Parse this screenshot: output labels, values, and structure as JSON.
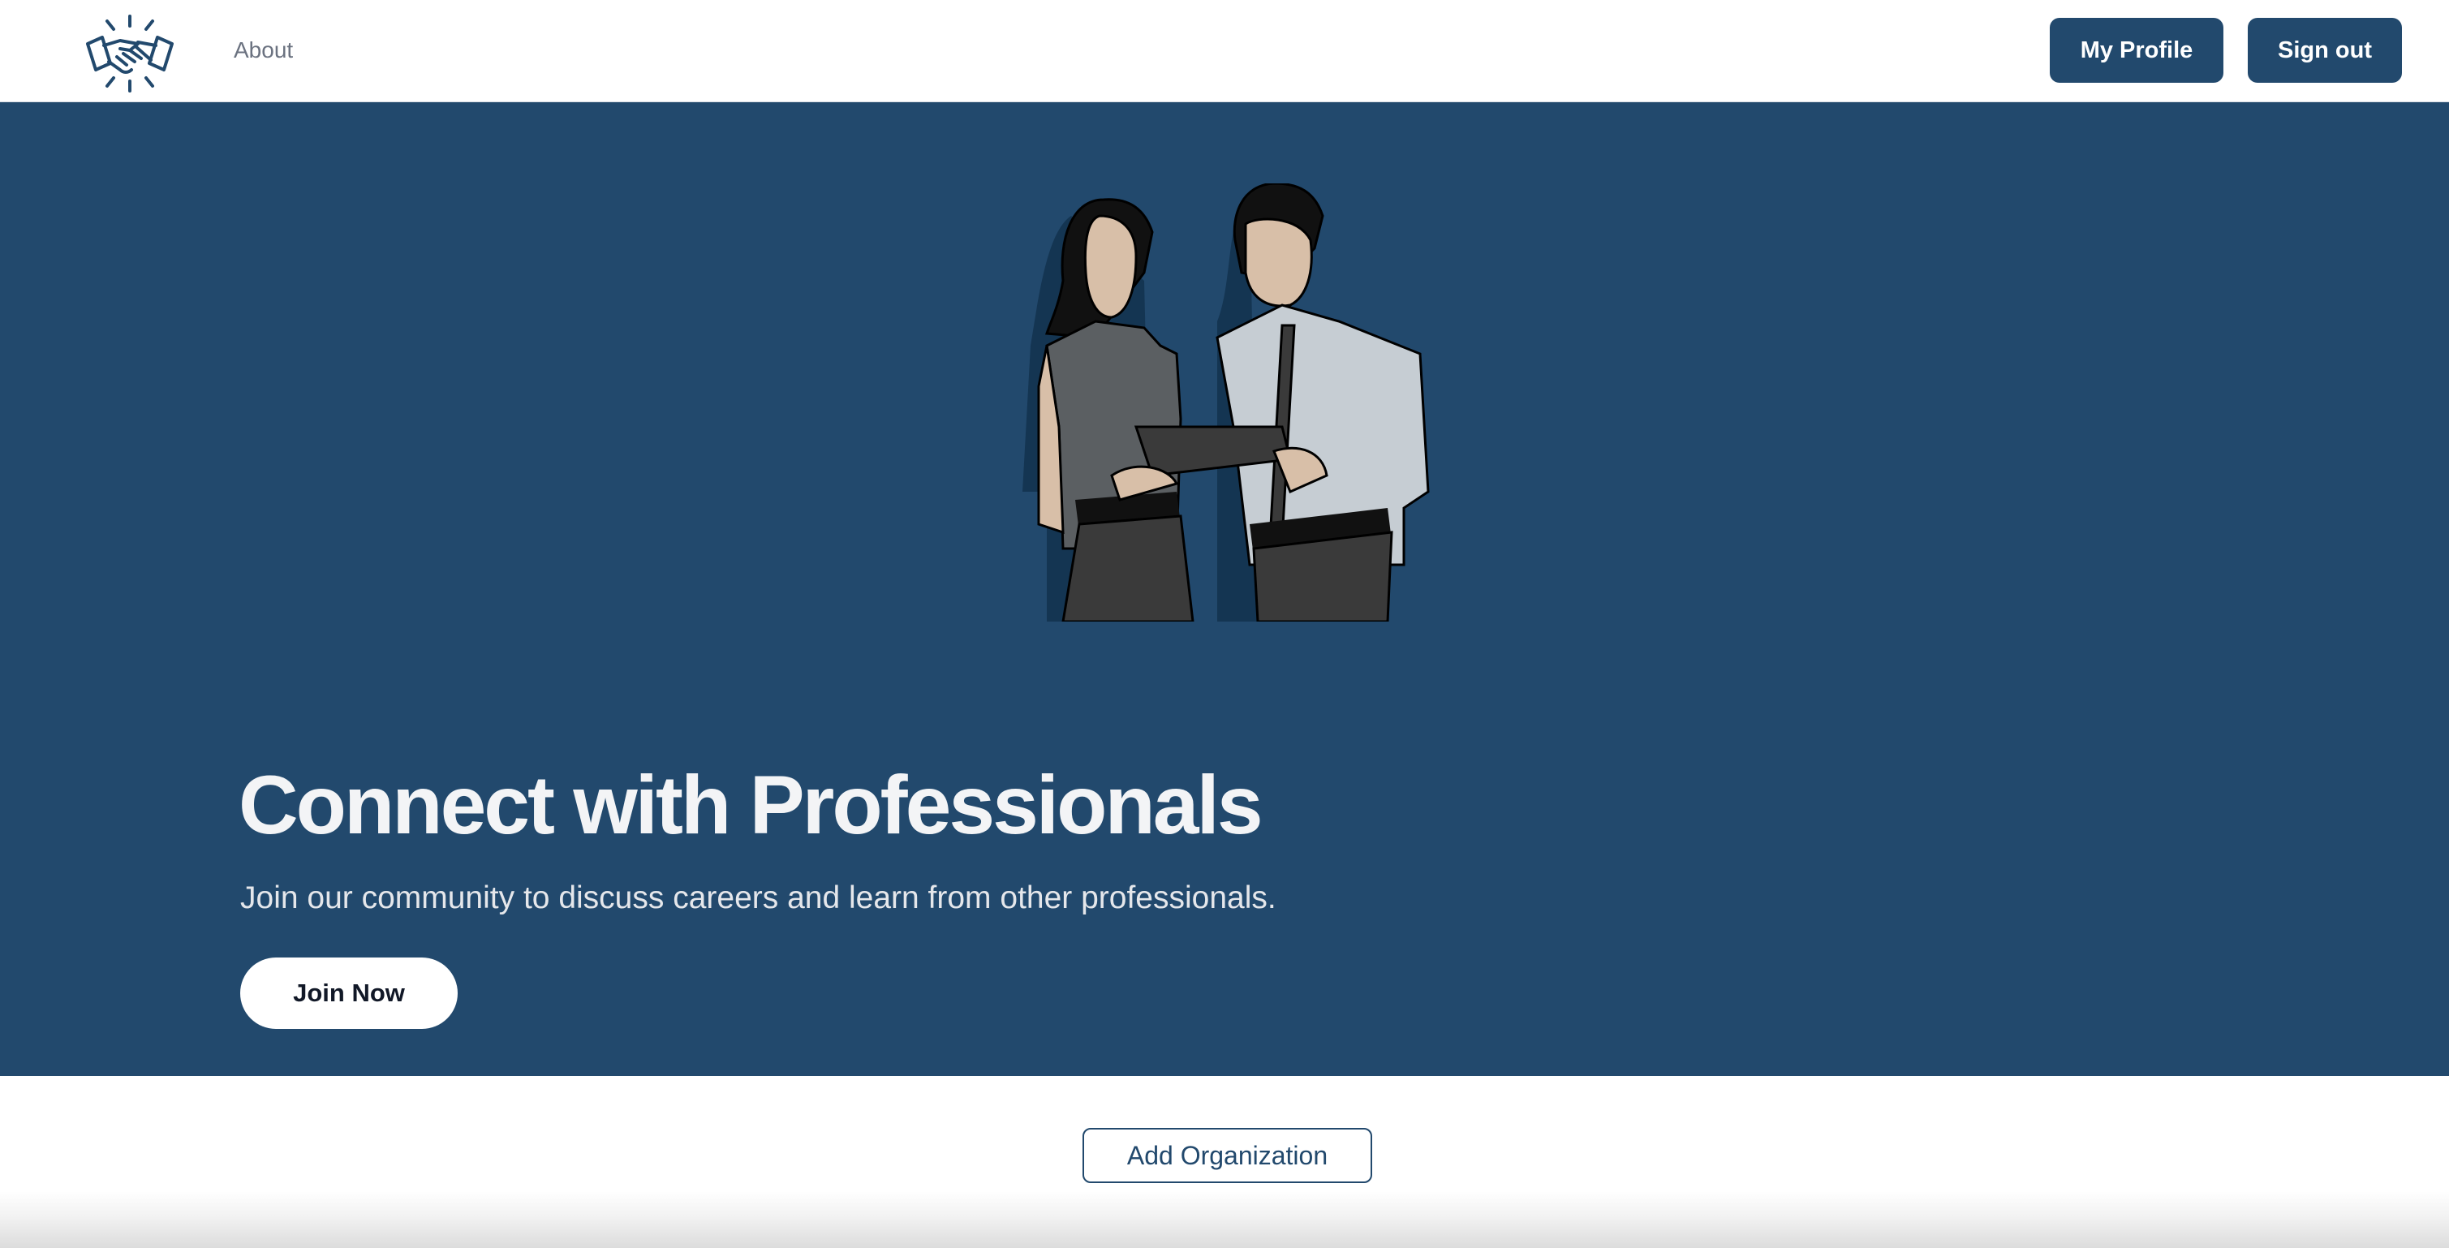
{
  "navbar": {
    "logo_icon": "handshake-icon",
    "about_label": "About",
    "my_profile_label": "My Profile",
    "sign_out_label": "Sign out"
  },
  "hero": {
    "illustration": "two-professionals-with-tablet",
    "title": "Connect with Professionals",
    "subtitle": "Join our community to discuss careers and learn from other professionals.",
    "cta_label": "Join Now"
  },
  "actions": {
    "add_organization_label": "Add Organization"
  },
  "colors": {
    "brand": "#22496d",
    "white": "#ffffff",
    "hero_text": "#f3f4f6"
  }
}
